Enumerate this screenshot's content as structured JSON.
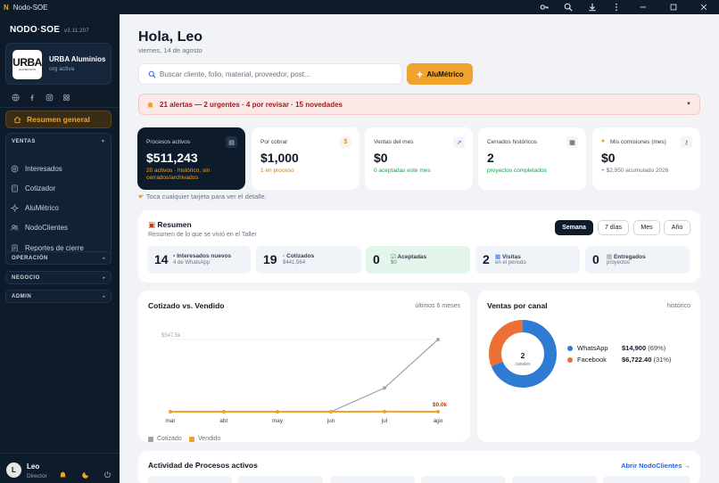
{
  "window": {
    "title": "Nodo-SOE",
    "logo_letter": "N"
  },
  "sidebar": {
    "brand": "NODO·SOE",
    "brand_main_a": "NODO",
    "brand_dot": "·",
    "brand_main_b": "SOE",
    "version": "v3.11.207",
    "org": {
      "logo_big": "URBA",
      "logo_small": "ALUMINIOS",
      "name": "URBA Aluminios",
      "status": "org activa"
    },
    "active_item": "Resumen general",
    "ventas": {
      "header": "VENTAS",
      "items": [
        "Interesados",
        "Cotizador",
        "AluMétrico",
        "NodoClientes",
        "Reportes de cierre"
      ]
    },
    "groups": [
      "OPERACIÓN",
      "NEGOCIO",
      "ADMIN"
    ],
    "user": {
      "initial": "L",
      "name": "Leo",
      "role": "Director"
    }
  },
  "header": {
    "greeting": "Hola, Leo",
    "date": "viernes, 14 de agosto"
  },
  "search": {
    "placeholder": "Buscar cliente, folio, material, proveedor, post..."
  },
  "alumetrico_button": "AluMétrico",
  "alerts": {
    "text": "21 alertas — 2 urgentes · 4 por revisar · 15 novedades"
  },
  "kpis": [
    {
      "label": "Procesos activos",
      "value": "$511,243",
      "sub": "20 activos · histórico, sin cerrados/archivados",
      "sub_color": "#f0a32c"
    },
    {
      "label": "Por cobrar",
      "value": "$1,000",
      "sub": "1 en proceso",
      "sub_color": "#d97706"
    },
    {
      "label": "Ventas del mes",
      "value": "$0",
      "sub": "0 aceptadas este mes",
      "sub_color": "#16a34a"
    },
    {
      "label": "Cerrados históricos",
      "value": "2",
      "sub": "proyectos completados",
      "sub_color": "#16a34a"
    },
    {
      "label": "Mis comisiones (mes)",
      "value": "$0",
      "sub": "+ $2,950 acumulado 2026",
      "sub_color": "#6b7280"
    }
  ],
  "hint": "Toca cualquier tarjeta para ver el detalle.",
  "resumen": {
    "title": "Resumen",
    "subtitle": "Resumen de lo que se vivió en el Taller",
    "periods": [
      "Semana",
      "7 días",
      "Mes",
      "Año"
    ],
    "active_period": "Semana",
    "stats": [
      {
        "num": "14",
        "label": "Interesados nuevos",
        "sub": "4 de WhatsApp"
      },
      {
        "num": "19",
        "label": "Cotizados",
        "sub": "$441,564"
      },
      {
        "num": "0",
        "label": "Aceptadas",
        "sub": "$0"
      },
      {
        "num": "2",
        "label": "Visitas",
        "sub": "en el periodo"
      },
      {
        "num": "0",
        "label": "Entregados",
        "sub": "proyectos"
      }
    ]
  },
  "chart_data": [
    {
      "type": "line",
      "title": "Cotizado vs. Vendido",
      "range_label": "últimos 6 meses",
      "categories": [
        "mar",
        "abr",
        "may",
        "jun",
        "jul",
        "ago"
      ],
      "series": [
        {
          "name": "Cotizado",
          "values": [
            0,
            0,
            0,
            0,
            180000,
            547500
          ],
          "color": "#9ca3af"
        },
        {
          "name": "Vendido",
          "values": [
            0,
            0,
            0,
            0,
            1000,
            0
          ],
          "color": "#f0a32c"
        }
      ],
      "ylim": [
        0,
        547500
      ],
      "annotations": {
        "max_label": "$547.5k",
        "last_vendido_label": "$0.0k"
      }
    },
    {
      "type": "pie",
      "title": "Ventas por canal",
      "range_label": "histórico",
      "center_value": "2",
      "center_label": "canales",
      "slices": [
        {
          "name": "WhatsApp",
          "value": 14900,
          "display": "$14,900",
          "pct": "(69%)",
          "color": "#2f7bd3"
        },
        {
          "name": "Facebook",
          "value": 6722.4,
          "display": "$6,722.40",
          "pct": "(31%)",
          "color": "#ec6f35"
        }
      ]
    }
  ],
  "actividad": {
    "title": "Actividad de Procesos activos",
    "link": "Abrir NodoClientes →"
  }
}
